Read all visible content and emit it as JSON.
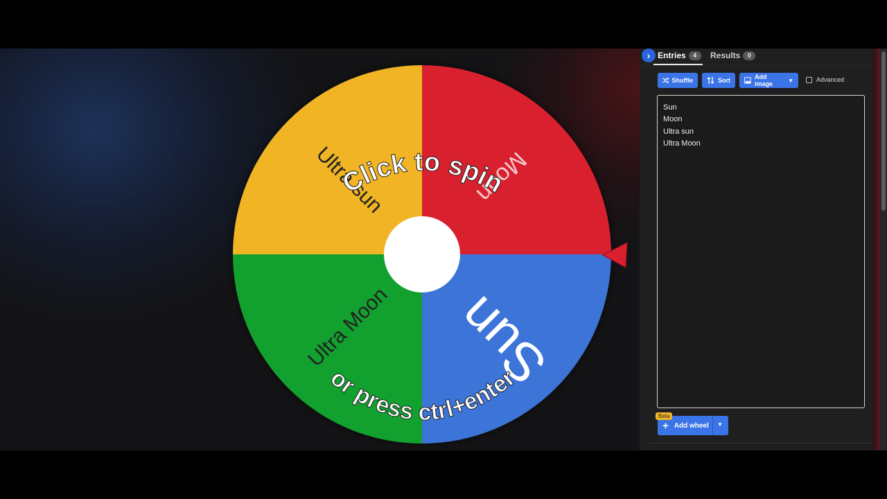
{
  "wheel": {
    "cta_line1": "Click to spin",
    "cta_line2": "or press ctrl+enter",
    "segments": [
      {
        "label": "Moon",
        "color": "#d9202f"
      },
      {
        "label": "Sun",
        "color": "#3c74d8"
      },
      {
        "label": "Ultra Moon",
        "color": "#12a02e"
      },
      {
        "label": "Ultra sun",
        "color": "#f0b425"
      }
    ],
    "pointer_color": "#d9202f",
    "hub_color": "#ffffff"
  },
  "panel": {
    "tabs": [
      {
        "label": "Entries",
        "count": "4"
      },
      {
        "label": "Results",
        "count": "0"
      }
    ],
    "toolbar": {
      "shuffle_label": "Shuffle",
      "sort_label": "Sort",
      "add_image_label": "Add image",
      "advanced_label": "Advanced"
    },
    "entries": [
      "Sun",
      "Moon",
      "Ultra sun",
      "Ultra Moon"
    ],
    "add_wheel_label": "Add wheel",
    "beta_label": "Beta",
    "accent_color": "#3b74e6"
  }
}
